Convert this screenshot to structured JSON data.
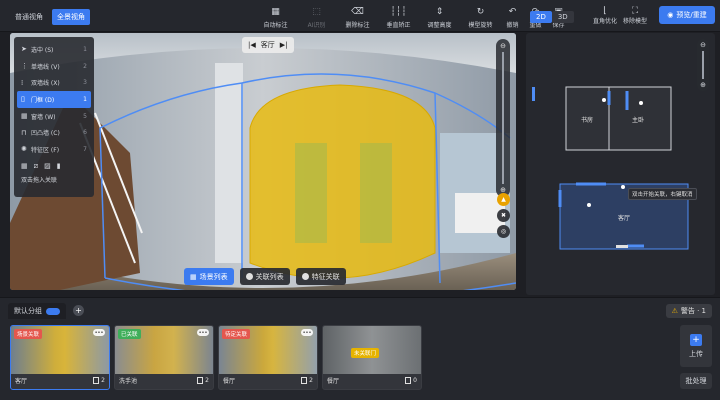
{
  "view_switch": {
    "normal": "普通视角",
    "full": "全景视角"
  },
  "toolbar": [
    {
      "label": "自动标注",
      "icon": "auto-label-icon",
      "disabled": false
    },
    {
      "label": "AI识别",
      "icon": "ai-recognize-icon",
      "disabled": true
    },
    {
      "label": "删除标注",
      "icon": "delete-label-icon",
      "disabled": false
    },
    {
      "label": "垂直矫正",
      "icon": "vertical-correct-icon",
      "disabled": false
    },
    {
      "label": "调整高度",
      "icon": "adjust-height-icon",
      "disabled": false
    },
    {
      "label": "模型旋转",
      "icon": "model-rotate-icon",
      "disabled": false
    }
  ],
  "history": {
    "undo": "撤销",
    "redo": "重做",
    "save": "保存"
  },
  "map_mode": {
    "d2": "2D",
    "d3": "3D"
  },
  "map_tools": {
    "right_angle": "直角优化",
    "remove_model": "移除模型"
  },
  "preview_button": "预览/重建",
  "viewer": {
    "room_title": "客厅",
    "tool_menu": [
      {
        "label": "选中 (S)",
        "key": "1",
        "icon": "cursor-icon"
      },
      {
        "label": "单墙线 (V)",
        "key": "2",
        "icon": "single-wall-icon"
      },
      {
        "label": "双墙线 (X)",
        "key": "3",
        "icon": "double-wall-icon"
      },
      {
        "label": "门框 (D)",
        "key": "1",
        "icon": "door-frame-icon",
        "active": true
      },
      {
        "label": "窗墙 (W)",
        "key": "5",
        "icon": "window-wall-icon"
      },
      {
        "label": "凹凸墙 (C)",
        "key": "6",
        "icon": "concave-wall-icon"
      },
      {
        "label": "特征区 (F)",
        "key": "7",
        "icon": "feature-area-icon"
      }
    ],
    "hint": "双击拖入关联",
    "bottom_tabs": [
      "场景列表",
      "关联列表",
      "特征关联"
    ]
  },
  "map": {
    "rooms": [
      "书房",
      "主卧",
      "客厅"
    ],
    "tooltip": "双击开始关联，右键取消"
  },
  "bottom": {
    "group": "默认分组",
    "warning": "警告 · 1",
    "upload": "上传",
    "batch": "批处理",
    "thumbs": [
      {
        "badge": "场景关联",
        "badge_color": "#e4574d",
        "name": "客厅",
        "count": "2",
        "active": true
      },
      {
        "badge": "已关联",
        "badge_color": "#3fae5a",
        "name": "洗手池",
        "count": "2"
      },
      {
        "badge": "待定关联",
        "badge_color": "#e4574d",
        "name": "餐厅",
        "count": "2"
      },
      {
        "badge": "未关联门",
        "badge_color": "#e6b300",
        "name": "餐厅",
        "count": "0"
      }
    ]
  },
  "colors": {
    "accent": "#3c7bf0",
    "door_fill": "#e8bb12",
    "bg": "#1e1f24"
  }
}
